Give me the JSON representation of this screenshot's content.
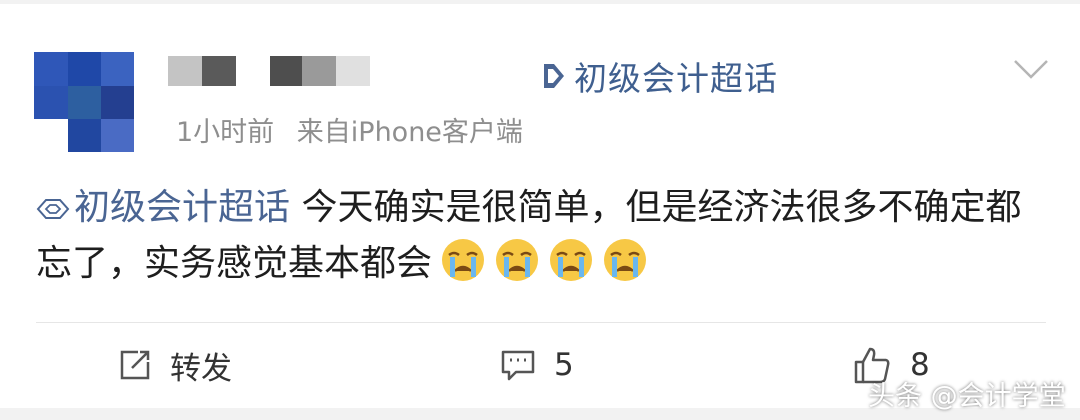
{
  "post": {
    "topic": "初级会计超话",
    "meta": {
      "time": "1小时前",
      "source": "来自iPhone客户端"
    },
    "content": {
      "topic": "初级会计超话",
      "text": " 今天确实是很简单，但是经济法很多不确定都忘了，实务感觉基本都会"
    },
    "emojis": [
      "crying-face-icon",
      "crying-face-icon",
      "crying-face-icon",
      "crying-face-icon"
    ]
  },
  "actions": {
    "repost_label": "转发",
    "comment_count": "5",
    "like_count": "8"
  },
  "watermark": "头条 @会计学堂",
  "colors": {
    "topic": "#3f5f8f",
    "meta": "#8e8e8e",
    "text": "#1e1e1e",
    "avatar_blue": "#2a4fa8"
  }
}
